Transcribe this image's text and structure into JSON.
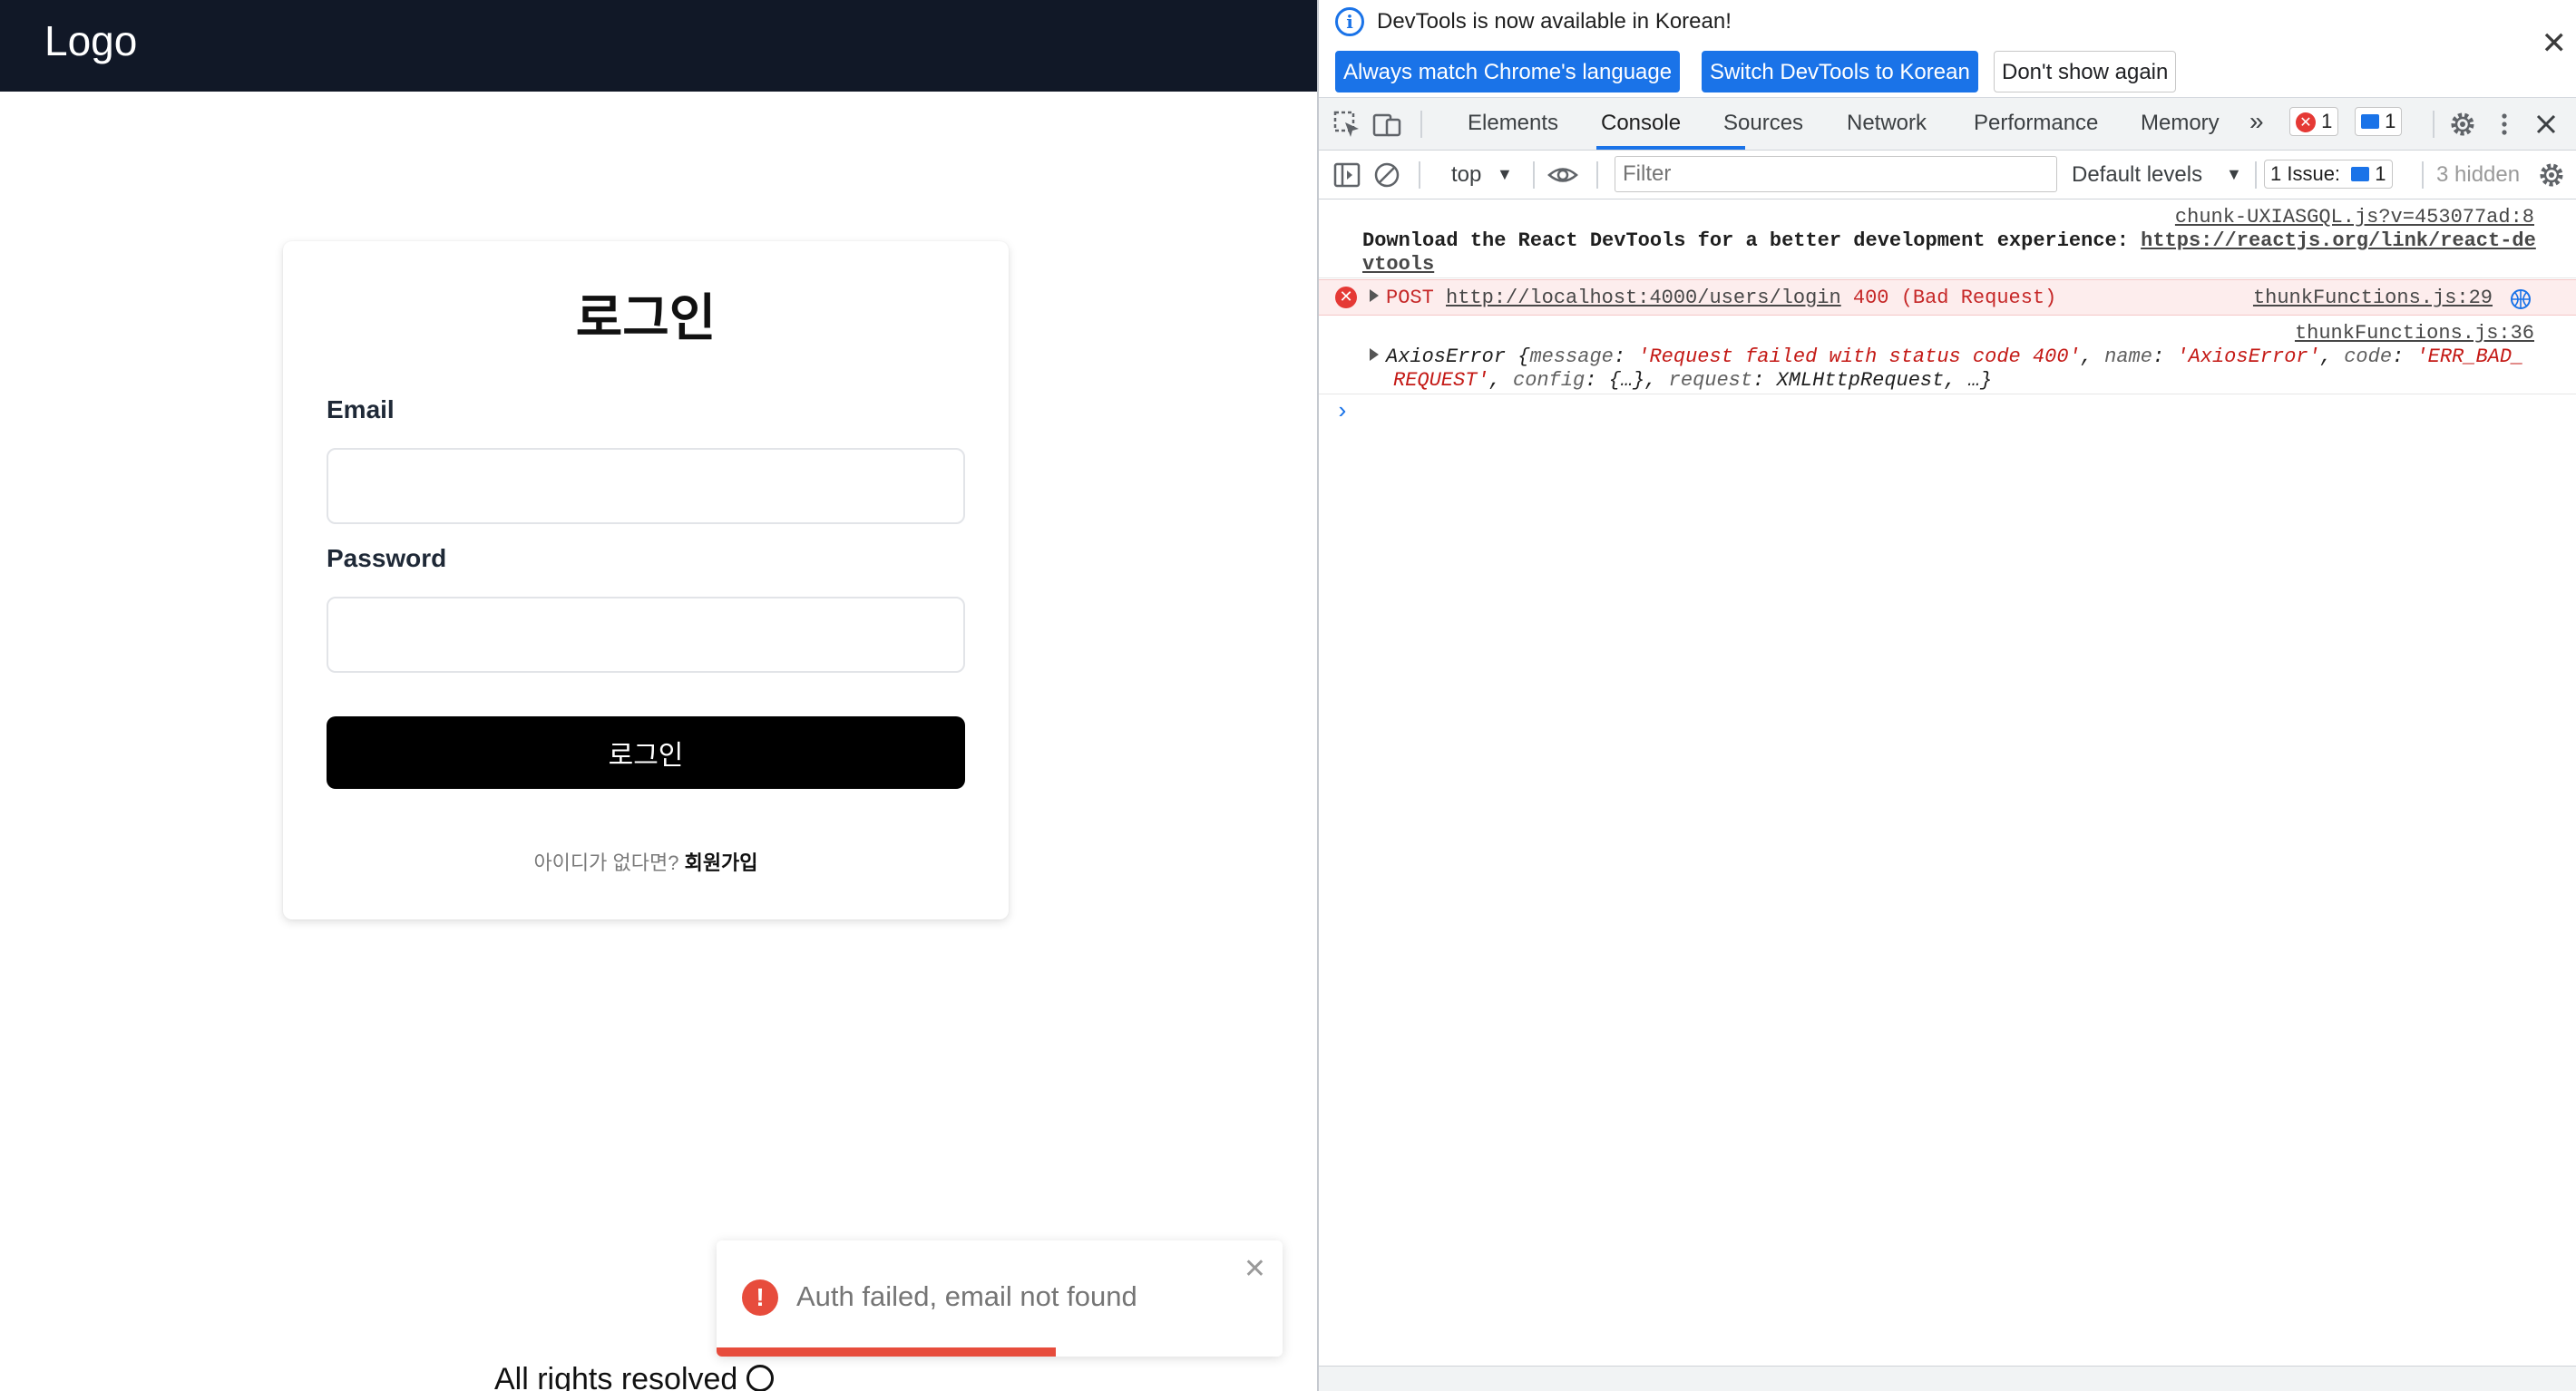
{
  "app": {
    "logo": "Logo",
    "login": {
      "title": "로그인",
      "email_label": "Email",
      "password_label": "Password",
      "submit_label": "로그인",
      "signup_question": "아이디가 없다면? ",
      "signup_link": "회원가입"
    },
    "footer": "All rights resolved",
    "toast": {
      "message": "Auth failed, email not found",
      "icon": "!",
      "close": "✕",
      "progress": 0.6,
      "color": "#e74c3c"
    }
  },
  "devtools": {
    "infobar": {
      "message": "DevTools is now available in Korean!",
      "buttons": [
        "Always match Chrome's language",
        "Switch DevTools to Korean",
        "Don't show again"
      ],
      "accent": "#1a73e8"
    },
    "tabs": [
      "Elements",
      "Console",
      "Sources",
      "Network",
      "Performance",
      "Memory"
    ],
    "active_tab": "Console",
    "error_count": "1",
    "message_count": "1",
    "toolbar": {
      "context": "top",
      "filter_placeholder": "Filter",
      "levels": "Default levels",
      "issues_label": "1 Issue:",
      "issues_count": "1",
      "hidden": "3 hidden"
    },
    "console": {
      "msg1_source": "chunk-UXIASGQL.js?v=453077ad:8",
      "msg1_text": "Download the React DevTools for a better development experience: ",
      "msg1_link_a": "https://reactjs.org/link/react-de",
      "msg1_link_b": "vtools",
      "err_method": "POST ",
      "err_url": "http://localhost:4000/users/login",
      "err_status": " 400 (Bad Request)",
      "err_source": "thunkFunctions.js:29",
      "obj_source": "thunkFunctions.js:36",
      "obj_name": "AxiosError",
      "obj_message": "'Request failed with status code 400'",
      "obj_errname": "'AxiosError'",
      "obj_code_a": "'ERR_BAD_",
      "obj_code_b": "REQUEST'",
      "obj_config": "{…}",
      "obj_request": "XMLHttpRequest"
    }
  }
}
